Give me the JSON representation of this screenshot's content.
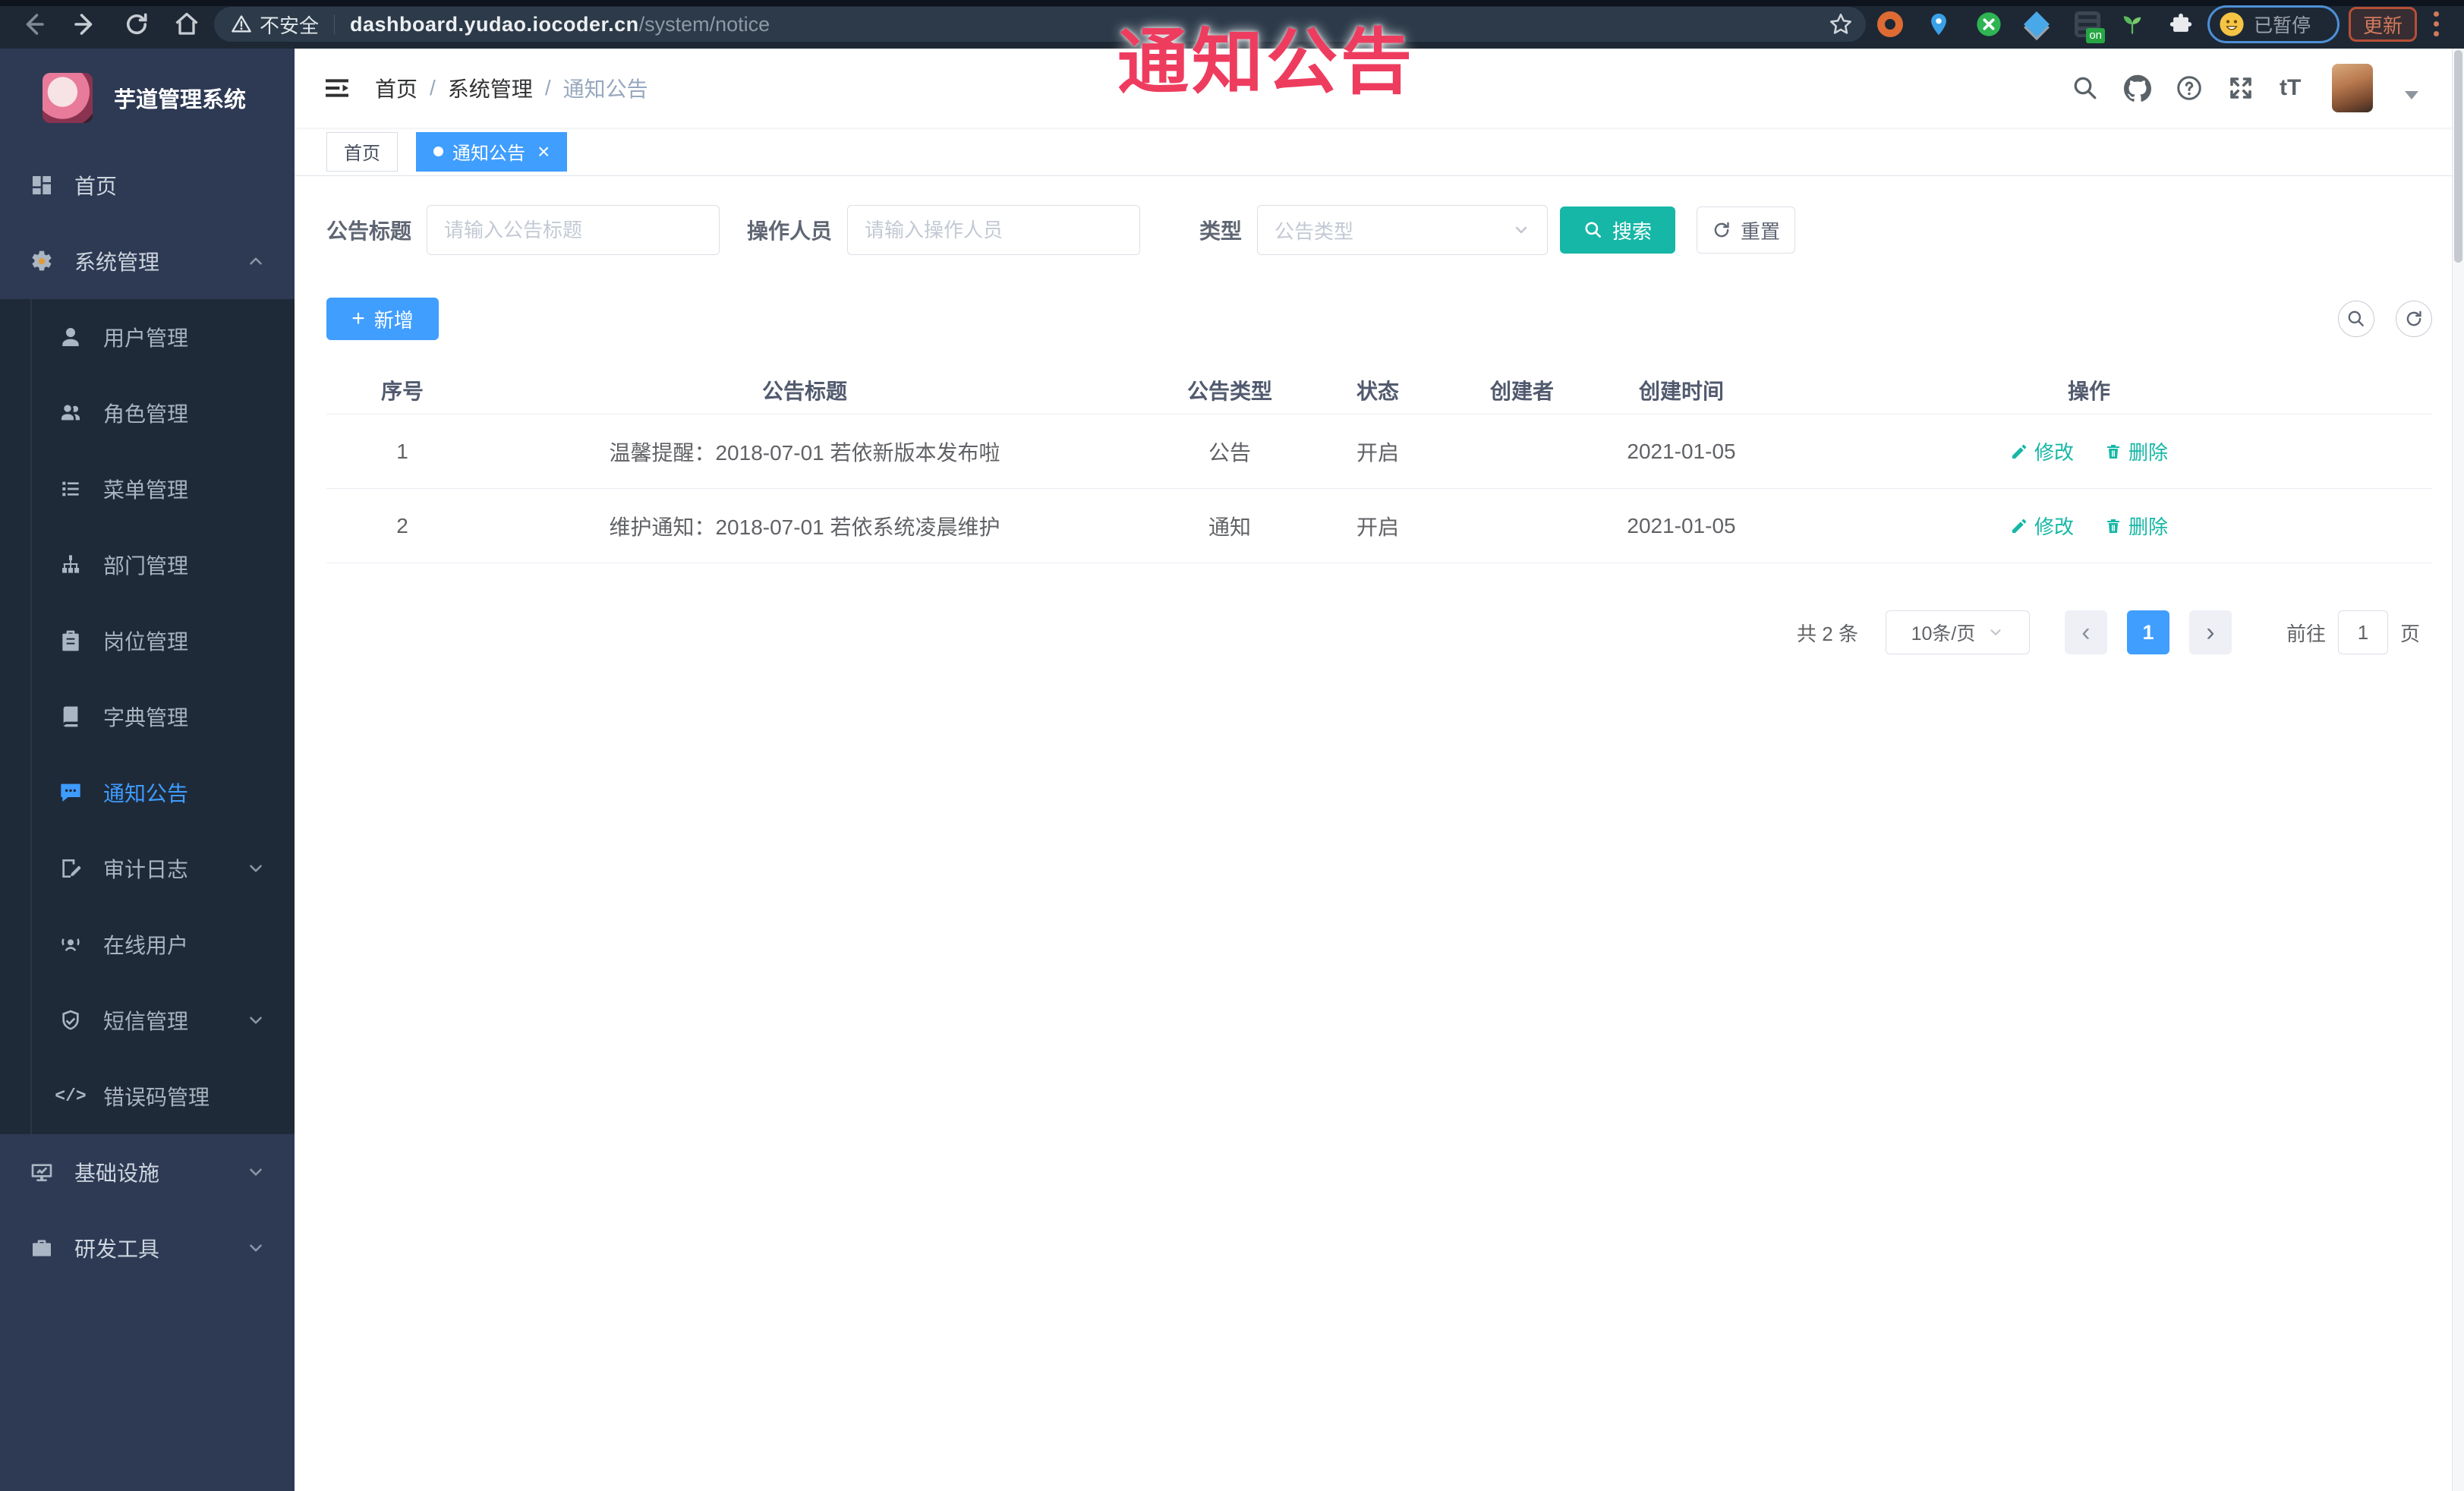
{
  "browser": {
    "security_label": "不安全",
    "url_host": "dashboard.yudao.iocoder.cn",
    "url_path": "/system/notice",
    "on_badge": "on",
    "paused_label": "已暂停",
    "update_label": "更新"
  },
  "watermark": {
    "text": "通知公告",
    "color": "#ee3c5f"
  },
  "sidebar": {
    "title": "芋道管理系统",
    "items": [
      {
        "label": "首页",
        "icon": "dashboard-icon",
        "level": 1
      },
      {
        "label": "系统管理",
        "icon": "gear-icon",
        "level": 1,
        "state": "expanded"
      },
      {
        "label": "用户管理",
        "icon": "user-icon",
        "level": 2
      },
      {
        "label": "角色管理",
        "icon": "roles-icon",
        "level": 2
      },
      {
        "label": "菜单管理",
        "icon": "menu-list-icon",
        "level": 2
      },
      {
        "label": "部门管理",
        "icon": "org-tree-icon",
        "level": 2
      },
      {
        "label": "岗位管理",
        "icon": "badge-icon",
        "level": 2
      },
      {
        "label": "字典管理",
        "icon": "dictionary-icon",
        "level": 2
      },
      {
        "label": "通知公告",
        "icon": "notice-bubble-icon",
        "level": 2,
        "active": true
      },
      {
        "label": "审计日志",
        "icon": "audit-log-icon",
        "level": 2,
        "state": "collapsed"
      },
      {
        "label": "在线用户",
        "icon": "online-users-icon",
        "level": 2
      },
      {
        "label": "短信管理",
        "icon": "sms-shield-icon",
        "level": 2,
        "state": "collapsed"
      },
      {
        "label": "错误码管理",
        "icon": "error-code-icon",
        "level": 2
      },
      {
        "label": "基础设施",
        "icon": "infrastructure-icon",
        "level": 1,
        "state": "collapsed"
      },
      {
        "label": "研发工具",
        "icon": "dev-tools-icon",
        "level": 1,
        "state": "collapsed"
      }
    ],
    "error_code_glyph": "</>"
  },
  "header": {
    "breadcrumb": [
      "首页",
      "系统管理",
      "通知公告"
    ],
    "separator": "/",
    "font_size_glyph": "tT"
  },
  "tabs": [
    {
      "label": "首页",
      "active": false
    },
    {
      "label": "通知公告",
      "active": true,
      "close_glyph": "×"
    }
  ],
  "filters": {
    "title_label": "公告标题",
    "title_placeholder": "请输入公告标题",
    "operator_label": "操作人员",
    "operator_placeholder": "请输入操作人员",
    "type_label": "类型",
    "type_placeholder": "公告类型",
    "search_label": "搜索",
    "reset_label": "重置"
  },
  "toolbar": {
    "add_label": "新增",
    "plus_glyph": "+"
  },
  "table": {
    "columns": [
      "序号",
      "公告标题",
      "公告类型",
      "状态",
      "创建者",
      "创建时间",
      "操作"
    ],
    "rows": [
      {
        "seq": "1",
        "title": "温馨提醒：2018-07-01 若依新版本发布啦",
        "type": "公告",
        "status": "开启",
        "creator": "",
        "created": "2021-01-05"
      },
      {
        "seq": "2",
        "title": "维护通知：2018-07-01 若依系统凌晨维护",
        "type": "通知",
        "status": "开启",
        "creator": "",
        "created": "2021-01-05"
      }
    ],
    "edit_label": "修改",
    "delete_label": "删除"
  },
  "pagination": {
    "total_text": "共 2 条",
    "page_size": "10条/页",
    "prev_glyph": "‹",
    "next_glyph": "›",
    "current_page": "1",
    "goto_label": "前往",
    "goto_value": "1",
    "page_unit": "页"
  },
  "colors": {
    "accent_blue": "#409eff",
    "teal": "#16b7a6",
    "chrome_bg": "#1d2834",
    "sidebar_bg": "#2e3a54",
    "submenu_bg": "#1f2a38",
    "watermark_pink": "#ee3c5f"
  }
}
